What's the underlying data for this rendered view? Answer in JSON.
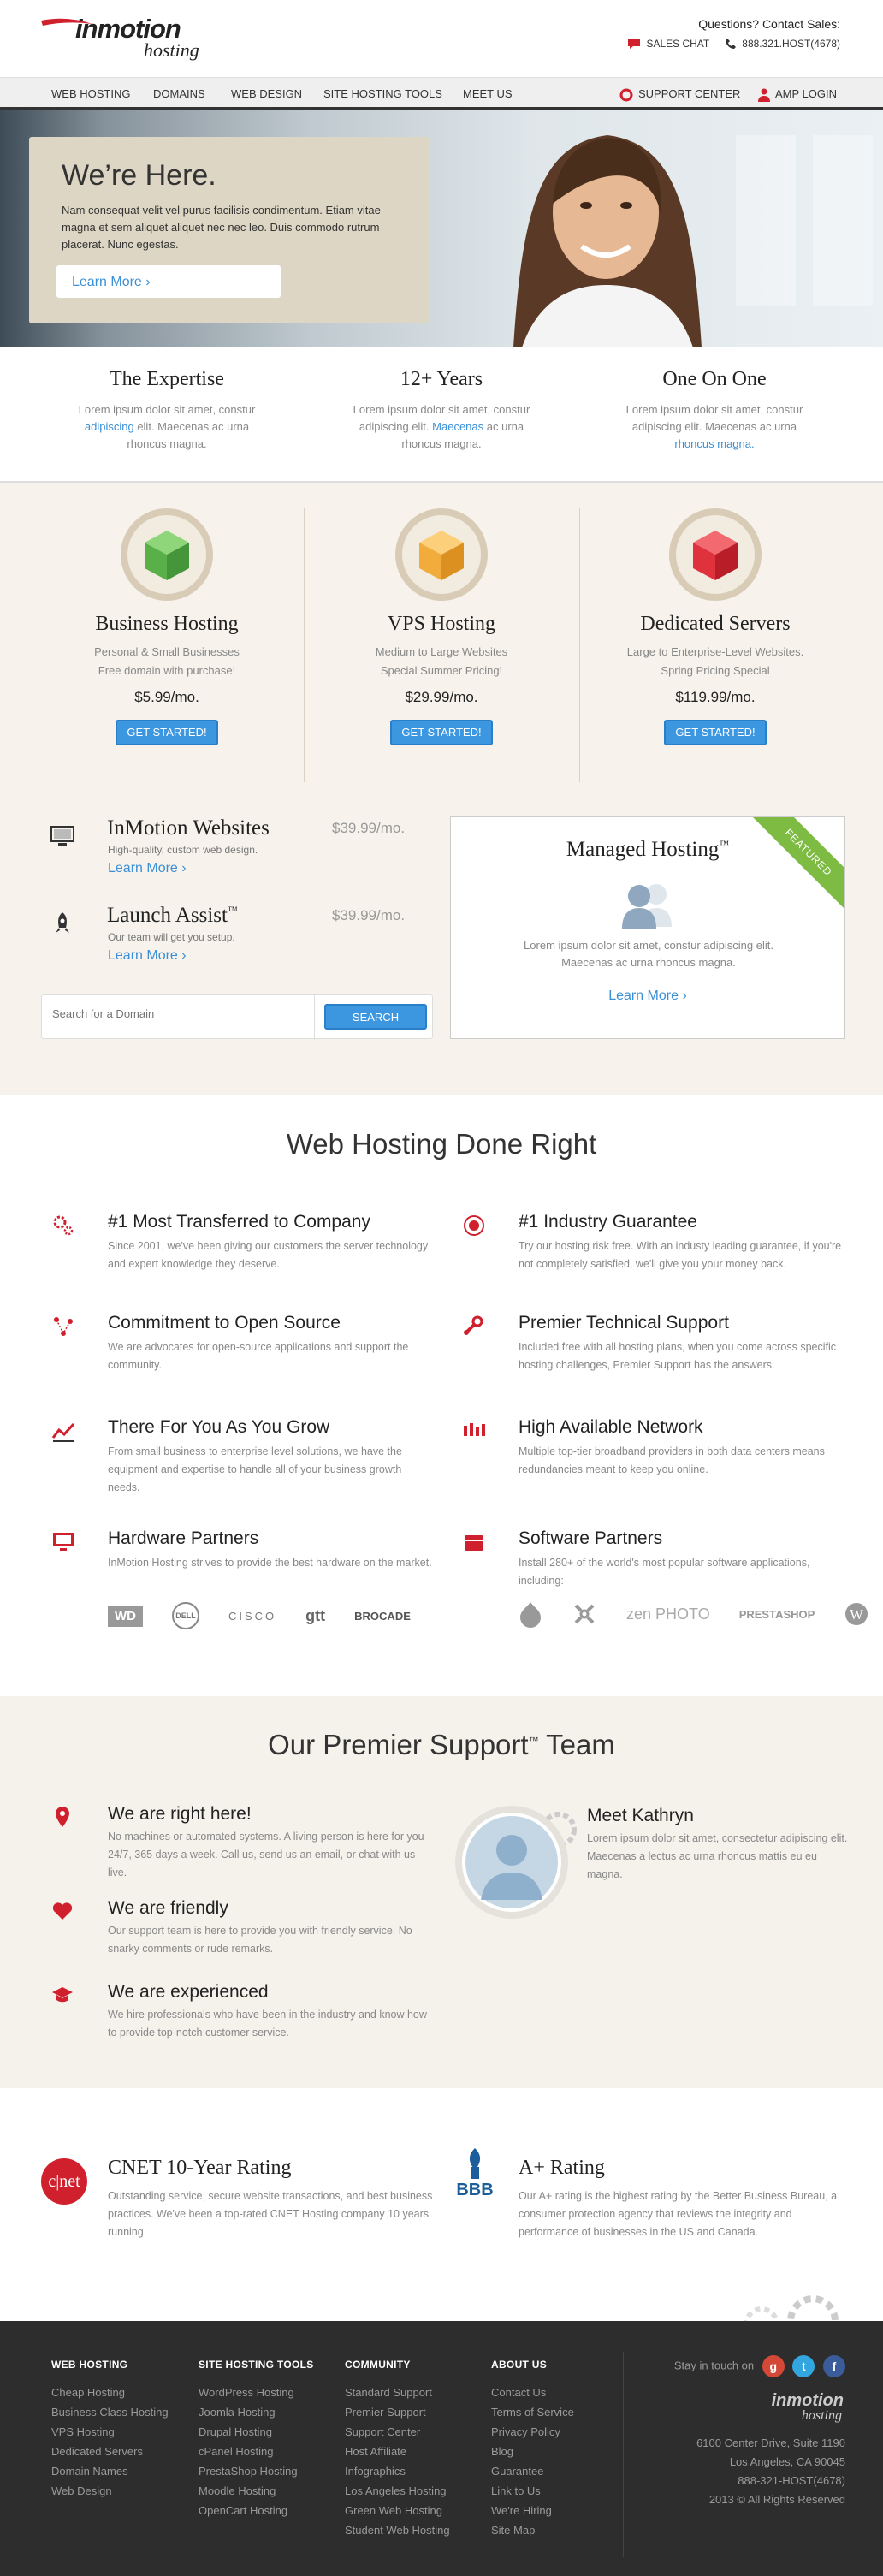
{
  "header": {
    "logo_word": "inmotion",
    "logo_sub": "hosting",
    "questions": "Questions? Contact Sales:",
    "sales_chat": "SALES CHAT",
    "phone": "888.321.HOST(4678)"
  },
  "nav": {
    "items": [
      "WEB HOSTING",
      "DOMAINS",
      "WEB DESIGN",
      "SITE HOSTING TOOLS",
      "MEET US"
    ],
    "support": "SUPPORT CENTER",
    "amp": "AMP LOGIN"
  },
  "hero": {
    "title": "We’re Here.",
    "text": "Nam consequat velit vel purus facilisis condimentum. Etiam vitae magna et sem aliquet aliquet nec nec leo. Duis commodo rutrum placerat. Nunc egestas.",
    "button": "Learn More"
  },
  "expertise": [
    {
      "title": "The Expertise",
      "l1": "Lorem ipsum dolor sit amet, constur",
      "l2a": "adipiscing",
      "l2b": " elit. Maecenas ac urna",
      "l3": "rhoncus magna."
    },
    {
      "title": "12+ Years",
      "l1": "Lorem ipsum dolor sit amet, constur",
      "l2a": "adipiscing elit. ",
      "l2b": "Maecenas",
      "l2c": " ac urna",
      "l3": "rhoncus magna."
    },
    {
      "title": "One On One",
      "l1": "Lorem ipsum dolor sit amet, constur",
      "l2": "adipiscing elit. Maecenas ac urna",
      "l3": "rhoncus magna."
    }
  ],
  "plans": [
    {
      "title": "Business Hosting",
      "d1": "Personal & Small Businesses",
      "d2": "Free domain with purchase!",
      "price": "$5.99/mo.",
      "button": "GET STARTED!",
      "color": "#6cbf5a"
    },
    {
      "title": "VPS Hosting",
      "d1": "Medium to Large Websites",
      "d2": "Special Summer Pricing!",
      "price": "$29.99/mo.",
      "button": "GET STARTED!",
      "color": "#f1ac3c"
    },
    {
      "title": "Dedicated Servers",
      "d1": "Large to Enterprise-Level Websites.",
      "d2": "Spring Pricing Special",
      "price": "$119.99/mo.",
      "button": "GET STARTED!",
      "color": "#e0323d"
    }
  ],
  "mini": [
    {
      "title": "InMotion Websites",
      "sub": "High-quality, custom web design.",
      "link": "Learn More",
      "price": "$39.99/mo."
    },
    {
      "title": "Launch Assist",
      "tm": "™",
      "sub": "Our team will get you setup.",
      "link": "Learn More",
      "price": "$39.99/mo."
    }
  ],
  "domain_search": {
    "placeholder": "Search for a Domain",
    "button": "SEARCH"
  },
  "managed": {
    "title": "Managed Hosting",
    "tm": "™",
    "ribbon": "FEATURED",
    "text": "Lorem ipsum dolor sit amet, constur adipiscing elit. Maecenas ac urna rhoncus magna.",
    "link": "Learn More"
  },
  "done_right": {
    "title": "Web Hosting Done Right",
    "features": [
      {
        "title": "#1 Most Transferred to Company",
        "text": "Since 2001, we've been giving our customers the server technology and expert knowledge they deserve."
      },
      {
        "title": "#1 Industry Guarantee",
        "text": "Try our hosting risk free. With an industy leading guarantee, if you're not completely satisfied, we'll give you your money back."
      },
      {
        "title": "Commitment to Open Source",
        "text": "We are advocates for open-source applications and support the community."
      },
      {
        "title": "Premier Technical Support",
        "text": "Included free with all hosting plans, when you come across specific hosting challenges, Premier Support has the answers."
      },
      {
        "title": "There For You As You Grow",
        "text": "From small business to enterprise level solutions, we have the equipment and expertise to handle all of your business growth needs."
      },
      {
        "title": "High Available Network",
        "text": "Multiple top-tier broadband providers in both data centers means redundancies meant to keep you online."
      },
      {
        "title": "Hardware Partners",
        "text": "InMotion Hosting strives to provide the best hardware on the market."
      },
      {
        "title": "Software Partners",
        "text": "Install 280+ of the world's most popular software applications, including:"
      }
    ],
    "hw_logos": [
      "WD",
      "DELL",
      "CISCO",
      "gtt",
      "BROCADE"
    ],
    "sw_logos": [
      "zen PHOTO",
      "PRESTASHOP"
    ]
  },
  "support": {
    "title": "Our Premier Support",
    "tm": "™",
    "title_end": " Team",
    "items": [
      {
        "title": "We are right here!",
        "text": "No machines or automated systems. A living person is here for you 24/7, 365 days a week. Call us, send us an email, or chat with us live."
      },
      {
        "title": "We are friendly",
        "text": "Our support team is here to provide you with friendly service. No snarky comments or rude remarks."
      },
      {
        "title": "We are experienced",
        "text": "We hire professionals who have been in the industry and know how to provide top-notch customer service."
      }
    ],
    "meet": {
      "title": "Meet Kathryn",
      "text": "Lorem ipsum dolor sit amet, consectetur adipiscing elit. Maecenas a lectus ac urna rhoncus mattis eu eu magna."
    }
  },
  "ratings": [
    {
      "badge": "c|net",
      "title": "CNET 10-Year Rating",
      "text": "Outstanding service, secure website transactions, and best business practices. We've been a top-rated CNET Hosting company 10 years running."
    },
    {
      "badge": "BBB",
      "title": "A+ Rating",
      "text": "Our A+ rating is the highest rating by the Better Business Bureau, a consumer protection agency that reviews the integrity and performance of businesses in the US and Canada."
    }
  ],
  "footer": {
    "cols": [
      {
        "title": "WEB HOSTING",
        "items": [
          "Cheap Hosting",
          "Business Class Hosting",
          "VPS Hosting",
          "Dedicated Servers",
          "Domain Names",
          "Web Design"
        ]
      },
      {
        "title": "SITE HOSTING TOOLS",
        "items": [
          "WordPress Hosting",
          "Joomla Hosting",
          "Drupal Hosting",
          "cPanel Hosting",
          "PrestaShop Hosting",
          "Moodle Hosting",
          "OpenCart Hosting"
        ]
      },
      {
        "title": "COMMUNITY",
        "items": [
          "Standard Support",
          "Premier Support",
          "Support Center",
          "Host Affiliate",
          "Infographics",
          "Los Angeles Hosting",
          "Green Web Hosting",
          "Student Web Hosting"
        ]
      },
      {
        "title": "ABOUT US",
        "items": [
          "Contact Us",
          "Terms of Service",
          "Privacy Policy",
          "Blog",
          "Guarantee",
          "Link to Us",
          "We're Hiring",
          "Site Map"
        ]
      }
    ],
    "stay": "Stay in touch on",
    "logo_word": "inmotion",
    "logo_sub": "hosting",
    "address1": "6100 Center Drive, Suite 1190",
    "address2": "Los Angeles, CA 90045",
    "phone": "888-321-HOST(4678)",
    "copyright": "2013 © All Rights Reserved"
  }
}
